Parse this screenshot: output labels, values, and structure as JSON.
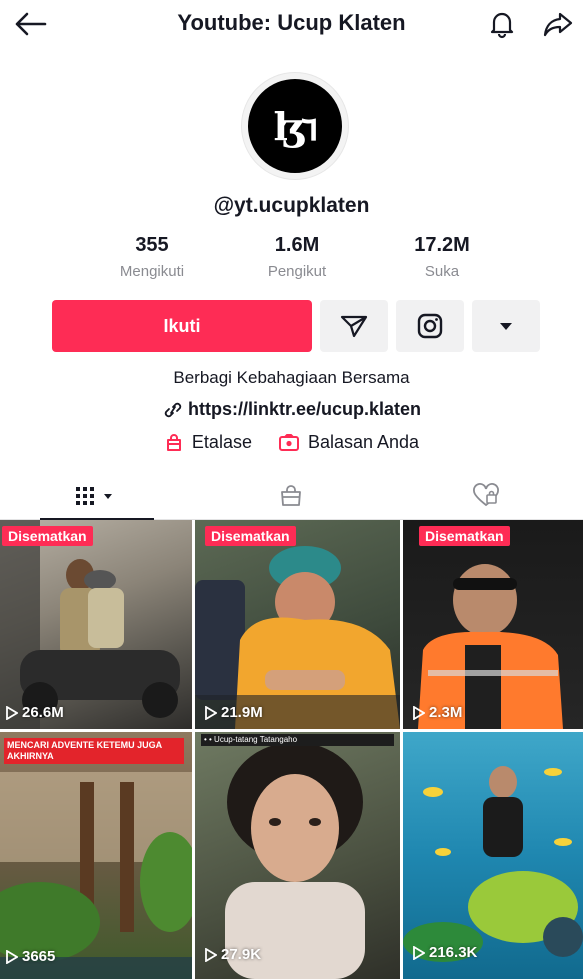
{
  "header": {
    "title": "Youtube: Ucup Klaten",
    "back_icon": "arrow-left-icon",
    "bell_icon": "bell-icon",
    "share_icon": "share-icon"
  },
  "profile": {
    "avatar_text": "ɮꭋ",
    "handle": "@yt.ucupklaten",
    "stats": {
      "following": {
        "value": "355",
        "label": "Mengikuti"
      },
      "followers": {
        "value": "1.6M",
        "label": "Pengikut"
      },
      "likes": {
        "value": "17.2M",
        "label": "Suka"
      }
    },
    "follow_label": "Ikuti",
    "bio": "Berbagi Kebahagiaan Bersama",
    "link": "https://linktr.ee/ucup.klaten",
    "showcase_label": "Etalase",
    "replies_label": "Balasan Anda"
  },
  "tabs": [
    {
      "icon": "grid-icon",
      "active": true
    },
    {
      "icon": "shopping-bag-icon",
      "active": false
    },
    {
      "icon": "liked-heart-icon",
      "active": false
    }
  ],
  "videos": [
    {
      "pinned": true,
      "pin_label": "Disematkan",
      "views": "26.6M"
    },
    {
      "pinned": true,
      "pin_label": "Disematkan",
      "views": "21.9M"
    },
    {
      "pinned": true,
      "pin_label": "Disematkan",
      "views": "2.3M"
    },
    {
      "pinned": false,
      "views": "3665",
      "caption": "MENCARI ADVENTE KETEMU JUGA AKHIRNYA"
    },
    {
      "pinned": false,
      "views": "27.9K",
      "caption": "• • Ucup-tatang Tatangaho"
    },
    {
      "pinned": false,
      "views": "216.3K",
      "caption": ""
    }
  ],
  "colors": {
    "accent": "#fe2c55",
    "text": "#161823",
    "muted": "#8a8b91",
    "button_bg": "#f1f1f2"
  }
}
